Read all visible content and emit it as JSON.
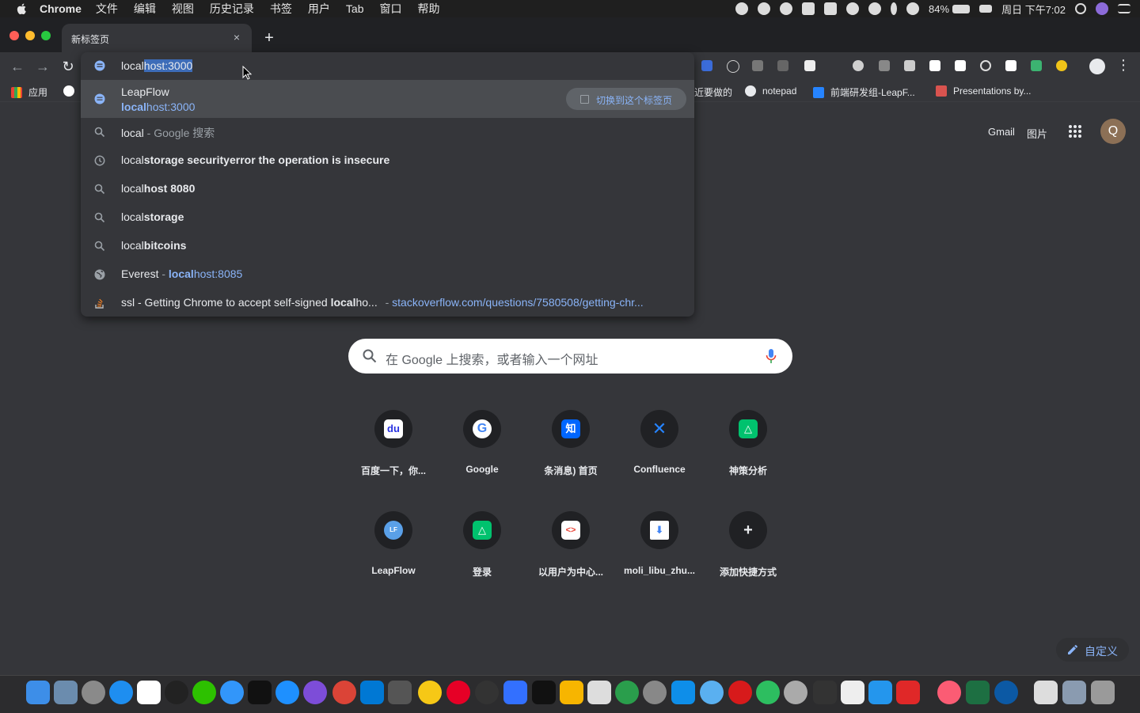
{
  "menubar": {
    "items": [
      "Chrome",
      "文件",
      "编辑",
      "视图",
      "历史记录",
      "书签",
      "用户",
      "Tab",
      "窗口",
      "帮助"
    ],
    "battery": "84%",
    "clock": "周日 下午7:02"
  },
  "tab": {
    "title": "新标签页",
    "close": "×"
  },
  "newtab": "+",
  "toolbar": {
    "back": "←",
    "forward": "→",
    "reload": "↻",
    "menu": "⋮"
  },
  "omnibox": {
    "typed": "local",
    "autocomplete": "host:3000",
    "selected": {
      "title": "LeapFlow",
      "url_bold": "local",
      "url_rest": "host:3000",
      "switch_label": "切换到这个标签页"
    },
    "suggestions": [
      {
        "icon": "search-icon",
        "prefix": "local",
        "bold": "",
        "suffix": " - Google 搜索"
      },
      {
        "icon": "history-icon",
        "prefix": "local",
        "bold": "storage securityerror the operation is insecure",
        "suffix": ""
      },
      {
        "icon": "search-icon",
        "prefix": "local",
        "bold": "host 8080",
        "suffix": ""
      },
      {
        "icon": "search-icon",
        "prefix": "local",
        "bold": "storage",
        "suffix": ""
      },
      {
        "icon": "search-icon",
        "prefix": "local",
        "bold": "bitcoins",
        "suffix": ""
      }
    ],
    "everest": {
      "title": "Everest",
      "sep": " - ",
      "url_bold": "local",
      "url_rest": "host:8085"
    },
    "ssl": {
      "text_pre": "ssl - Getting Chrome to accept self-signed ",
      "text_bold": "local",
      "text_post": "ho...",
      "sep": " - ",
      "url": "stackoverflow.com/questions/7580508/getting-chr..."
    }
  },
  "bookmarks": [
    {
      "label": "应用",
      "color": "#e94235"
    },
    {
      "label": "近要做的",
      "color": ""
    },
    {
      "label": "notepad",
      "color": "#e8eaed"
    },
    {
      "label": "前端研发组-LeapF...",
      "color": "#2684ff"
    },
    {
      "label": "Presentations by...",
      "color": "#d9534f"
    }
  ],
  "ntp": {
    "gmail": "Gmail",
    "images": "图片",
    "avatar": "Q",
    "search_placeholder": "在 Google 上搜索，或者输入一个网址",
    "shortcuts": [
      {
        "label": "百度一下，你...",
        "glyph": "du",
        "color": "#2932e1"
      },
      {
        "label": "Google",
        "glyph": "G",
        "color": "#4285f4"
      },
      {
        "label": "条消息) 首页",
        "glyph": "知",
        "color": "#0066ff"
      },
      {
        "label": "Confluence",
        "glyph": "✕",
        "color": "#2684ff"
      },
      {
        "label": "神策分析",
        "glyph": "△",
        "color": "#00c26e"
      },
      {
        "label": "LeapFlow",
        "glyph": "LF",
        "color": "#5aa0e8"
      },
      {
        "label": "登录",
        "glyph": "△",
        "color": "#00c26e"
      },
      {
        "label": "以用户为中心...",
        "glyph": "<>",
        "color": "#e94235"
      },
      {
        "label": "moli_libu_zhu...",
        "glyph": "⬇",
        "color": "#4285f4"
      },
      {
        "label": "添加快捷方式",
        "glyph": "+",
        "color": "#202124"
      }
    ],
    "customize": "自定义"
  }
}
